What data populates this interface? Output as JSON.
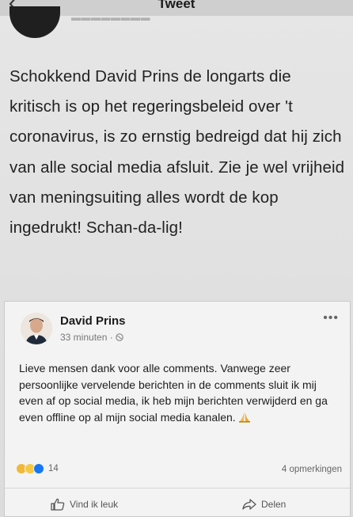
{
  "header": {
    "title": "Tweet"
  },
  "tweet": {
    "text": "Schokkend David Prins de longarts die kritisch is op het regeringsbeleid over 't coronavirus, is zo ernstig bedreigd dat hij zich van alle social media afsluit. Zie je wel vrijheid van meningsuiting alles wordt de kop ingedrukt! Schan-da-lig!"
  },
  "fb_post": {
    "author": "David Prins",
    "time": "33 minuten ·",
    "text": "Lieve mensen dank voor alle comments. Vanwege zeer persoonlijke vervelende berichten in de comments sluit ik mij even af op social media, ik heb mijn berichten verwijderd en ga even offline op al mijn social media kanalen.",
    "reaction_count": "14",
    "comments": "4 opmerkingen",
    "like_label": "Vind ik leuk",
    "share_label": "Delen",
    "reaction_icons": [
      "care-icon",
      "sad-icon",
      "like-icon"
    ],
    "colors": {
      "like_blue": "#1877f2",
      "sad_yellow": "#f7c843",
      "care_yellow": "#f0b93a"
    }
  }
}
